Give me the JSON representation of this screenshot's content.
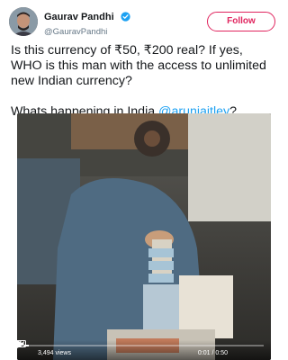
{
  "header": {
    "display_name": "Gaurav Pandhi",
    "handle": "@GauravPandhi",
    "follow_label": "Follow"
  },
  "tweet": {
    "text_main": "Is this currency of ₹50, ₹200 real? If yes, WHO is this man with the access to unlimited new Indian currency?",
    "text_line2_prefix": "Whats happening in India ",
    "mention": "@arunjaitley",
    "text_line2_suffix": "?"
  },
  "video": {
    "views": "3,494 views",
    "time": "0:01 / 0:50",
    "progress": 0.02
  },
  "colors": {
    "accent": "#1da1f2",
    "follow": "#e0245e",
    "verified": "#1da1f2"
  }
}
